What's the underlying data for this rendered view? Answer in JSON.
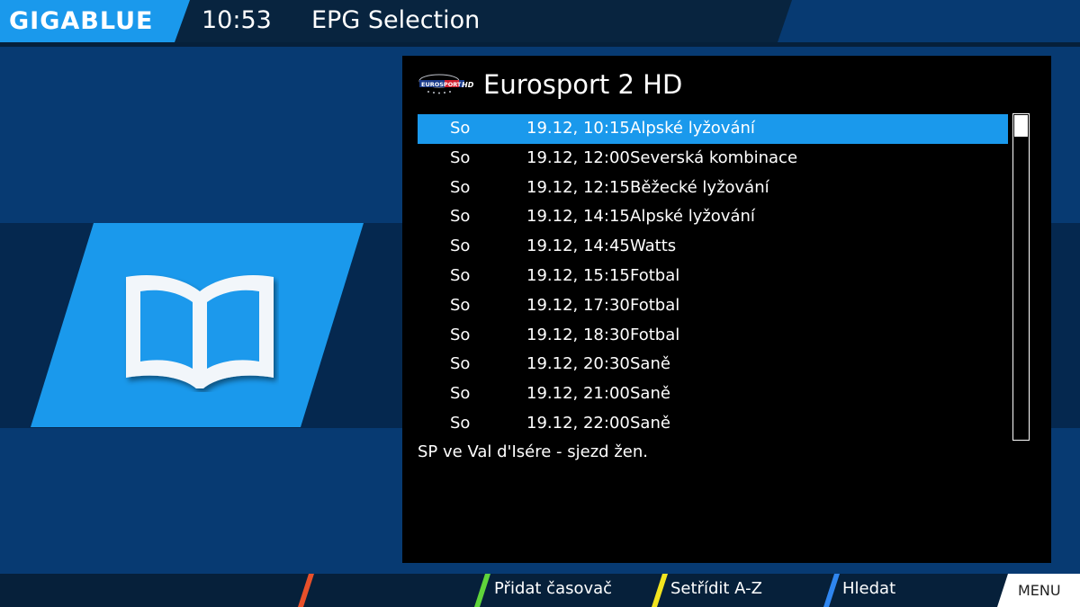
{
  "header": {
    "logo_text": "GIGABLUE",
    "time": "10:53",
    "title": "EPG Selection"
  },
  "channel": {
    "logo_text": "EUROSPORT 2 HD",
    "name": "Eurosport 2 HD"
  },
  "events": [
    {
      "day": "So",
      "datetime": "19.12, 10:15",
      "title": "Alpské lyžování",
      "selected": true
    },
    {
      "day": "So",
      "datetime": "19.12, 12:00",
      "title": "Severská kombinace"
    },
    {
      "day": "So",
      "datetime": "19.12, 12:15",
      "title": "Běžecké lyžování"
    },
    {
      "day": "So",
      "datetime": "19.12, 14:15",
      "title": "Alpské lyžování"
    },
    {
      "day": "So",
      "datetime": "19.12, 14:45",
      "title": "Watts"
    },
    {
      "day": "So",
      "datetime": "19.12, 15:15",
      "title": "Fotbal"
    },
    {
      "day": "So",
      "datetime": "19.12, 17:30",
      "title": "Fotbal"
    },
    {
      "day": "So",
      "datetime": "19.12, 18:30",
      "title": "Fotbal"
    },
    {
      "day": "So",
      "datetime": "19.12, 20:30",
      "title": "Saně"
    },
    {
      "day": "So",
      "datetime": "19.12, 21:00",
      "title": "Saně"
    },
    {
      "day": "So",
      "datetime": "19.12, 22:00",
      "title": "Saně"
    }
  ],
  "description": "SP ve Val d'Isére - sjezd žen.",
  "footer": {
    "red_label": "",
    "green_label": "Přidat časovač",
    "yellow_label": "Setřídit A-Z",
    "blue_label": "Hledat",
    "menu_label": "MENU"
  },
  "icons": {
    "header_icon": "book-icon"
  },
  "colors": {
    "accent": "#1a99ec",
    "background": "#073a72",
    "band": "#05284f",
    "red_key": "#e8502a",
    "green_key": "#5fd43a",
    "yellow_key": "#f2e41f",
    "blue_key": "#2f86f0"
  }
}
